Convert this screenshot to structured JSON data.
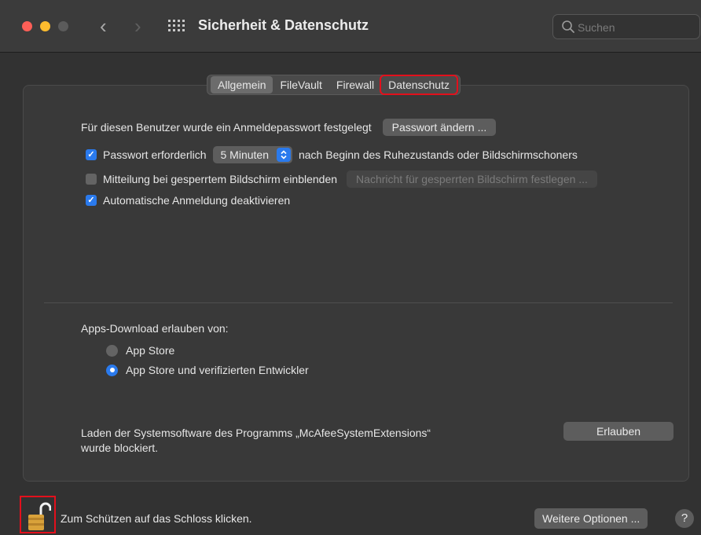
{
  "window": {
    "title": "Sicherheit & Datenschutz",
    "search_placeholder": "Suchen"
  },
  "tabs": [
    {
      "label": "Allgemein",
      "active": true
    },
    {
      "label": "FileVault",
      "active": false
    },
    {
      "label": "Firewall",
      "active": false
    },
    {
      "label": "Datenschutz",
      "active": false,
      "highlighted": true
    }
  ],
  "general": {
    "password_set_text": "Für diesen Benutzer wurde ein Anmeldepasswort festgelegt",
    "change_password_button": "Passwort ändern ...",
    "require_password": {
      "label": "Passwort erforderlich",
      "checked": true,
      "select_value": "5 Minuten",
      "suffix": "nach Beginn des Ruhezustands oder Bildschirmschoners"
    },
    "lock_message": {
      "label": "Mitteilung bei gesperrtem Bildschirm einblenden",
      "checked": false,
      "button": "Nachricht für gesperrten Bildschirm festlegen ..."
    },
    "disable_auto_login": {
      "label": "Automatische Anmeldung deaktivieren",
      "checked": true
    }
  },
  "downloads": {
    "heading": "Apps-Download erlauben von:",
    "options": [
      {
        "label": "App Store",
        "selected": false
      },
      {
        "label": "App Store und verifizierten Entwickler",
        "selected": true
      }
    ]
  },
  "blocked": {
    "line1": "Laden der Systemsoftware des Programms „McAfeeSystemExtensions“",
    "line2": "wurde blockiert.",
    "allow_button": "Erlauben"
  },
  "footer": {
    "lock_text": "Zum Schützen auf das Schloss klicken.",
    "more_options_button": "Weitere Optionen ...",
    "help_label": "?"
  },
  "colors": {
    "accent": "#2a7aed",
    "highlight_box": "#e3101c",
    "close": "#fe5f57",
    "minimize": "#febc2e"
  }
}
